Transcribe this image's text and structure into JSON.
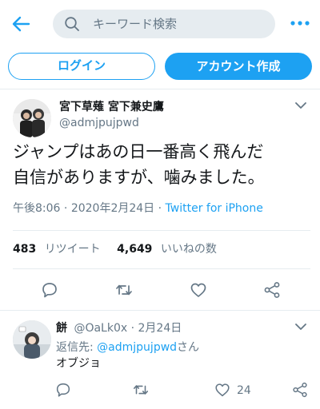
{
  "header": {
    "search_placeholder": "キーワード検索"
  },
  "auth": {
    "login_label": "ログイン",
    "signup_label": "アカウント作成"
  },
  "tweet": {
    "display_name": "宮下草薙 宮下兼史鷹",
    "handle": "@admjpujpwd",
    "text_line1": "ジャンプはあの日一番高く飛んだ",
    "text_line2": "自信がありますが、噛みました。",
    "time": "午後8:06",
    "date": "2020年2月24日",
    "source": "Twitter for iPhone",
    "retweets_count": "483",
    "retweets_label": "リツイート",
    "likes_count": "4,649",
    "likes_label": "いいねの数"
  },
  "reply": {
    "display_name": "餅",
    "handle": "@OaLk0x",
    "date": "2月24日",
    "replying_prefix": "返信先: ",
    "replying_handle": "@admjpujpwd",
    "replying_suffix": "さん",
    "text": "オブジョ",
    "like_count": "24"
  },
  "colors": {
    "accent": "#1da1f2",
    "secondary_text": "#657786",
    "divider": "#e6ecf0"
  }
}
